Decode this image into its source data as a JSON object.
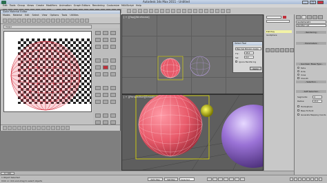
{
  "window": {
    "title": "Autodesk 3ds Max 2011 - Untitled"
  },
  "menu": {
    "items": [
      "Edit",
      "Tools",
      "Group",
      "Views",
      "Create",
      "Modifiers",
      "Animation",
      "Graph Editors",
      "Rendering",
      "Customize",
      "MAXScript",
      "Help"
    ]
  },
  "slate_editor": {
    "title": "Slate Material Editor",
    "menu": [
      "Modes",
      "Material",
      "Edit",
      "Select",
      "View",
      "Options",
      "Tools",
      "Utilities"
    ],
    "view_name": "View1"
  },
  "viewports": {
    "top": {
      "label": "[ + ][Top][Wireframe]"
    },
    "front": {
      "label": "[ + ][Front][Wireframe]"
    },
    "perspective": {
      "label": "[ + ][Perspective][Smooth + Highlights]"
    },
    "left": {
      "label": "[ + ][Left][Wireframe]"
    }
  },
  "dialog": {
    "title": "Select Tool",
    "dropdown": "Max Sel Polygon Angle",
    "row1_label": "Thr:",
    "row1_value": "45.0",
    "row2_label": "Sel:",
    "row2_value": "0.0",
    "checkbox": "Ignore Backfacing",
    "button": "Apply"
  },
  "command_panel": {
    "object_name": "GeoSphere01",
    "modifier_list": "Modifier List",
    "sections": [
      "Rendering",
      "Parameters",
      "Geodesic Base Type",
      "Selection",
      "Soft Selection"
    ],
    "options": [
      "Tetra",
      "Octa",
      "Icosa",
      "Smooth",
      "Hemisphere",
      "Base To Pivot",
      "Generate Mapping Coords"
    ],
    "segments_label": "Segments:",
    "segments_value": "4",
    "radius_label": "Radius:",
    "radius_value": "20.0"
  },
  "stack": {
    "items": [
      "Edit Poly",
      "GeoSphere"
    ]
  },
  "timeline": {
    "frame": "0 / 100"
  },
  "status": {
    "left": "1 Object Selected",
    "prompt": "Click or click-and-drag to select objects",
    "auto_key": "Auto Key",
    "set_key": "Set Key",
    "selected": "Selected"
  },
  "colors": {
    "sphere_red": "#e85a6a",
    "sphere_purple": "#8a62c4",
    "sphere_white": "#e8e8f2",
    "selection_yellow": "#e5e100",
    "swatch_red": "#c0303a"
  }
}
